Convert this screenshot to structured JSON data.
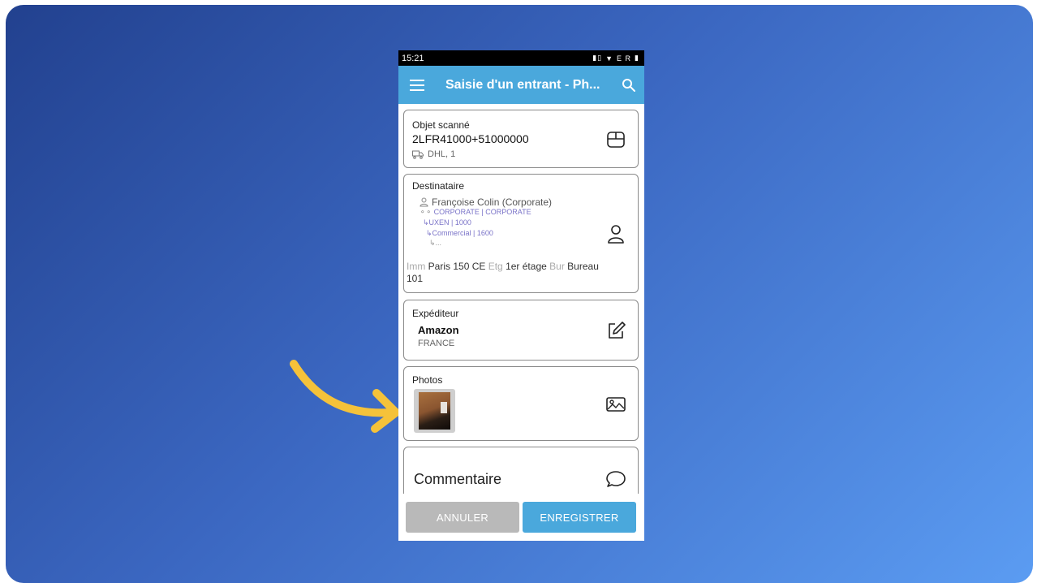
{
  "status_bar": {
    "time": "15:21",
    "icons_text": "E R"
  },
  "app_bar": {
    "title": "Saisie d'un entrant - Ph..."
  },
  "scanned": {
    "label": "Objet scanné",
    "code": "2LFR41000+51000000",
    "carrier": "DHL, 1"
  },
  "recipient": {
    "label": "Destinataire",
    "person": "Françoise Colin (Corporate)",
    "org_lines": [
      "CORPORATE | CORPORATE",
      "↳UXEN | 1000",
      "↳Commercial | 1600",
      "↳..."
    ],
    "location": {
      "imm_key": "Imm",
      "imm_val": "Paris 150 CE",
      "etg_key": "Etg",
      "etg_val": "1er étage",
      "bur_key": "Bur",
      "bur_val": "Bureau 101"
    }
  },
  "sender": {
    "label": "Expéditeur",
    "name": "Amazon",
    "country": "FRANCE"
  },
  "photos": {
    "label": "Photos"
  },
  "comment": {
    "label": "Commentaire"
  },
  "buttons": {
    "cancel": "ANNULER",
    "save": "ENREGISTRER"
  },
  "colors": {
    "accent": "#4aa8dc",
    "arrow": "#f5c23a",
    "org_text": "#7a73c8"
  },
  "icons": [
    "menu-icon",
    "search-icon",
    "box-icon",
    "truck-icon",
    "user-icon",
    "org-icon",
    "edit-icon",
    "image-icon",
    "comment-icon"
  ]
}
